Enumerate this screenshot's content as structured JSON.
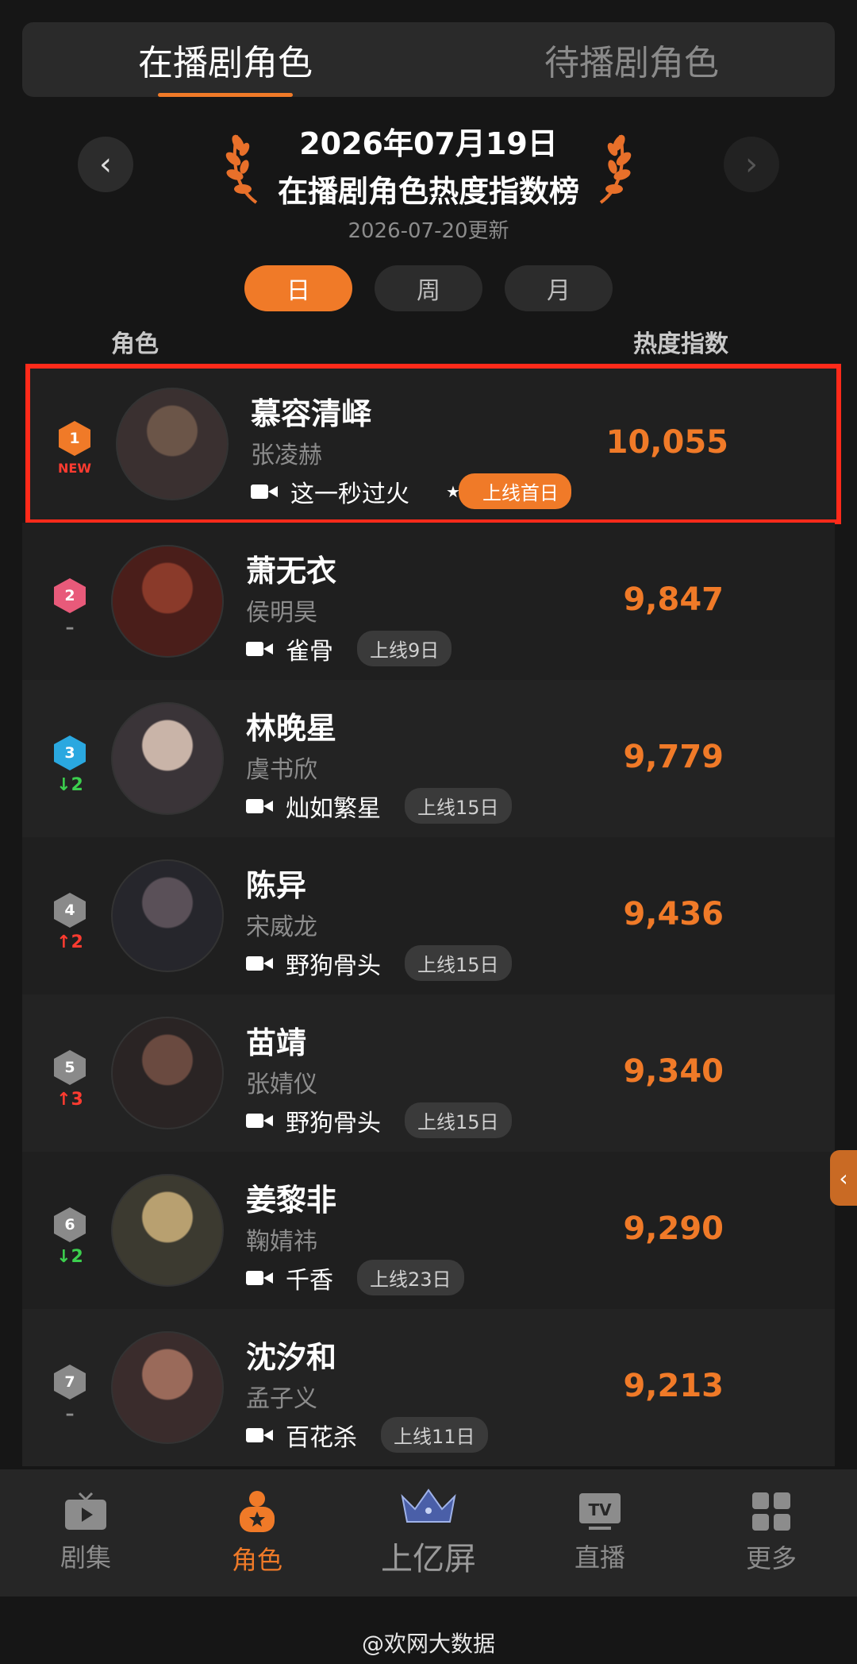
{
  "tabs": [
    {
      "label": "在播剧角色",
      "active": true
    },
    {
      "label": "待播剧角色",
      "active": false
    }
  ],
  "header": {
    "date": "2026年07月19日",
    "title": "在播剧角色热度指数榜",
    "updated": "2026-07-20更新",
    "prev_icon": "chevron-left-icon",
    "next_icon": "chevron-right-icon"
  },
  "periods": [
    {
      "label": "日",
      "active": true
    },
    {
      "label": "周",
      "active": false
    },
    {
      "label": "月",
      "active": false
    }
  ],
  "columns": {
    "role": "角色",
    "heat": "热度指数"
  },
  "colors": {
    "accent": "#f07a28",
    "highlight_border": "#ff2a1a",
    "up": "#ff3b30",
    "down": "#3ccf4e"
  },
  "rows": [
    {
      "rank": "1",
      "change": "NEW",
      "change_color": "#ff3b30",
      "badge_color": "#f07a28",
      "role": "慕容清峄",
      "actor": "张凌赫",
      "show": "这一秒过火",
      "tag": "上线首日",
      "tag_new": true,
      "heat": "10,055"
    },
    {
      "rank": "2",
      "change": "–",
      "change_color": "#8c8c8c",
      "badge_color": "#e85a7a",
      "role": "萧无衣",
      "actor": "侯明昊",
      "show": "雀骨",
      "tag": "上线9日",
      "tag_new": false,
      "heat": "9,847"
    },
    {
      "rank": "3",
      "change": "↓2",
      "change_color": "#3ccf4e",
      "badge_color": "#2aa8e0",
      "role": "林晚星",
      "actor": "虞书欣",
      "show": "灿如繁星",
      "tag": "上线15日",
      "tag_new": false,
      "heat": "9,779"
    },
    {
      "rank": "4",
      "change": "↑2",
      "change_color": "#ff3b30",
      "badge_color": "#8a8a8a",
      "role": "陈异",
      "actor": "宋威龙",
      "show": "野狗骨头",
      "tag": "上线15日",
      "tag_new": false,
      "heat": "9,436"
    },
    {
      "rank": "5",
      "change": "↑3",
      "change_color": "#ff3b30",
      "badge_color": "#8a8a8a",
      "role": "苗靖",
      "actor": "张婧仪",
      "show": "野狗骨头",
      "tag": "上线15日",
      "tag_new": false,
      "heat": "9,340"
    },
    {
      "rank": "6",
      "change": "↓2",
      "change_color": "#3ccf4e",
      "badge_color": "#8a8a8a",
      "role": "姜黎非",
      "actor": "鞠婧祎",
      "show": "千香",
      "tag": "上线23日",
      "tag_new": false,
      "heat": "9,290"
    },
    {
      "rank": "7",
      "change": "–",
      "change_color": "#8c8c8c",
      "badge_color": "#8a8a8a",
      "role": "沈汐和",
      "actor": "孟子义",
      "show": "百花杀",
      "tag": "上线11日",
      "tag_new": false,
      "heat": "9,213"
    }
  ],
  "bottom_nav": [
    {
      "label": "剧集",
      "icon": "tv-icon",
      "active": false
    },
    {
      "label": "角色",
      "icon": "person-star-icon",
      "active": true
    },
    {
      "label": "上亿屏",
      "icon": "crown-icon",
      "active": false
    },
    {
      "label": "直播",
      "icon": "tv-live-icon",
      "active": false
    },
    {
      "label": "更多",
      "icon": "grid-icon",
      "active": false
    }
  ],
  "watermark": "@欢网大数据"
}
